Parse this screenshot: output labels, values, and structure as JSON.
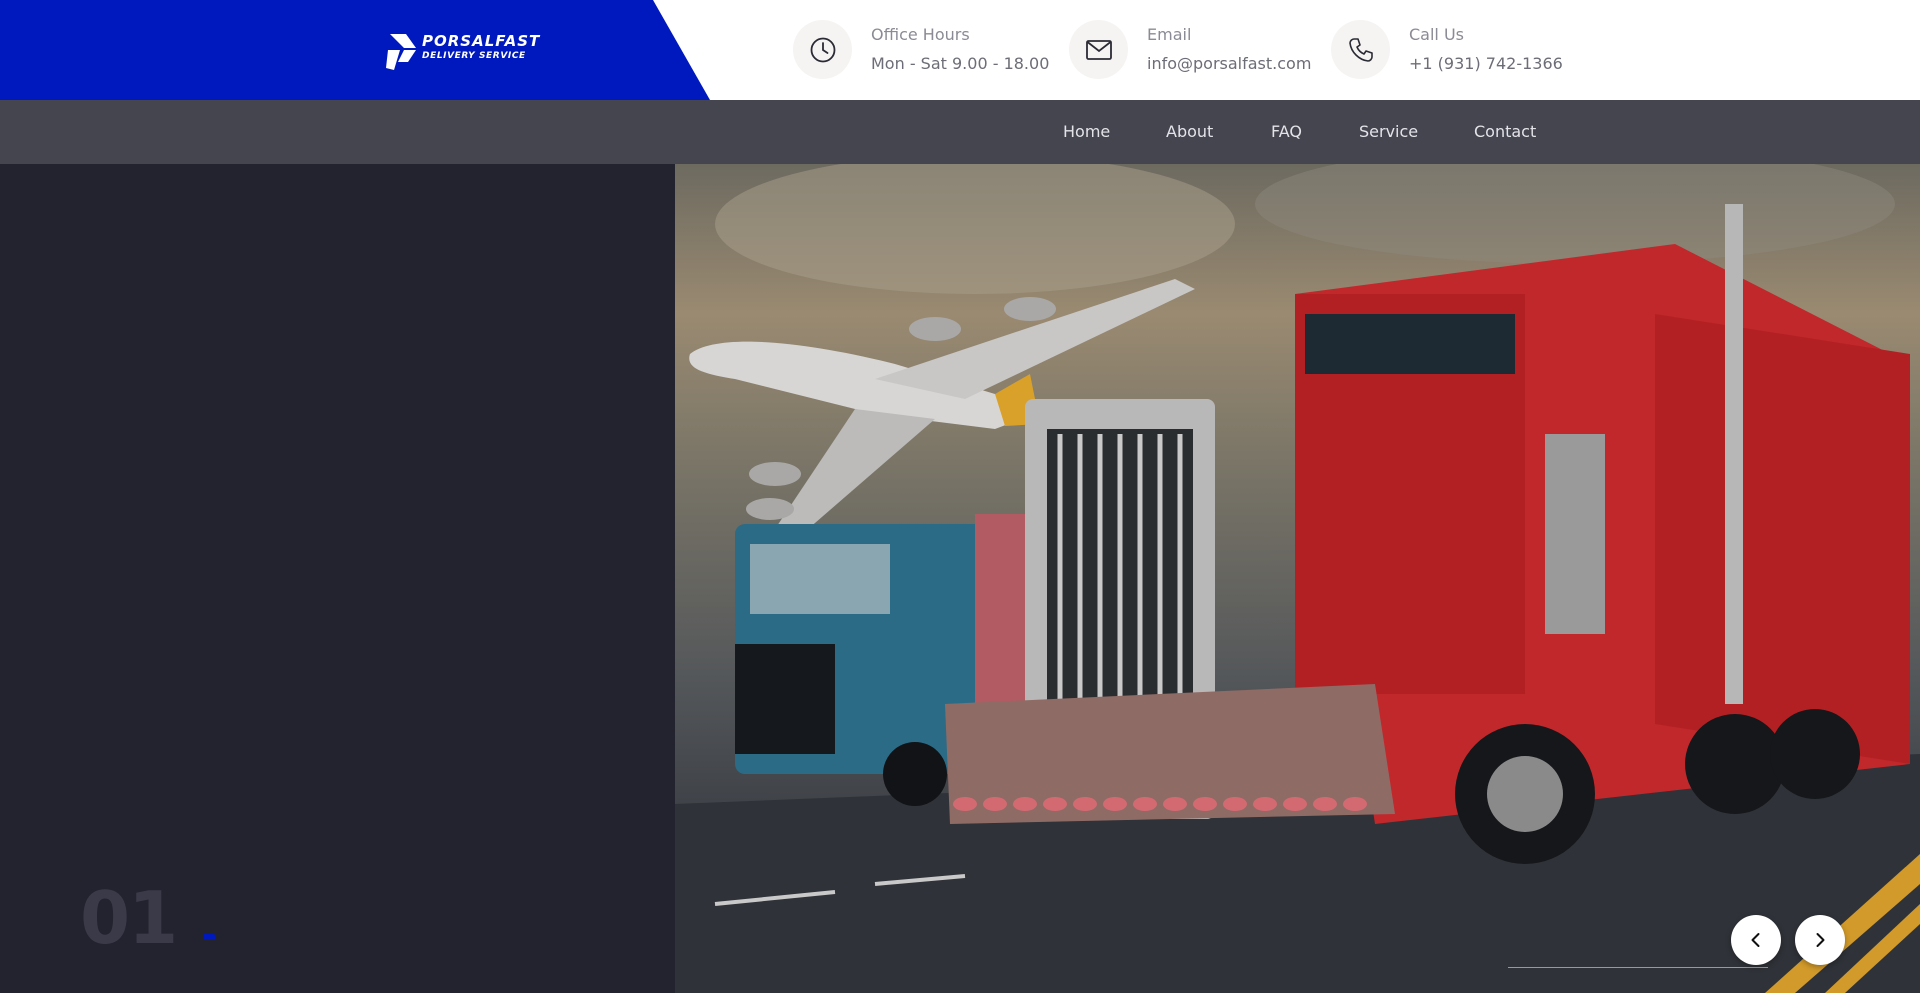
{
  "brand": {
    "name": "PORSALFAST",
    "tagline": "DELIVERY SERVICE",
    "color": "#0019bf"
  },
  "contact": {
    "office": {
      "label": "Office Hours",
      "value": "Mon - Sat 9.00 - 18.00",
      "icon": "clock-icon"
    },
    "email": {
      "label": "Email",
      "value": "info@porsalfast.com",
      "icon": "envelope-icon"
    },
    "phone": {
      "label": "Call Us",
      "value": "+1 (931) 742-1366",
      "icon": "phone-icon"
    }
  },
  "nav": {
    "items": [
      "Home",
      "About",
      "FAQ",
      "Service",
      "Contact"
    ]
  },
  "slider": {
    "current": "01",
    "prev_icon": "chevron-left-icon",
    "next_icon": "chevron-right-icon",
    "image_alt": "Red semi truck, blue truck and cargo airplane on a highway at sunset"
  }
}
